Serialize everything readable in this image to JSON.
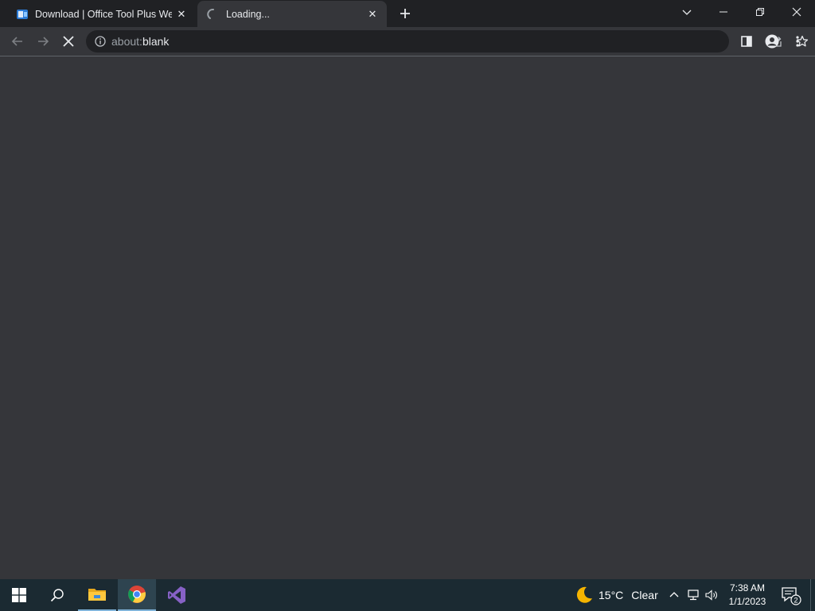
{
  "tabs": [
    {
      "title": "Download | Office Tool Plus Web",
      "favicon": "office-tool-plus-icon",
      "active": false
    },
    {
      "title": "Loading...",
      "favicon": "loading-spinner-icon",
      "active": true
    }
  ],
  "toolbar": {
    "url_scheme": "about:",
    "url_host": "blank"
  },
  "taskbar": {
    "pinned": [
      "windows-start-icon",
      "search-icon",
      "file-explorer-icon",
      "chrome-icon",
      "visual-studio-icon"
    ],
    "weather": {
      "temperature": "15°C",
      "condition": "Clear"
    },
    "clock": {
      "time": "7:38 AM",
      "date": "1/1/2023"
    },
    "notification_count": "2"
  },
  "colors": {
    "titlebar": "#202124",
    "toolbar": "#35363a",
    "content": "#35363a",
    "taskbar": "#1b2a32"
  }
}
